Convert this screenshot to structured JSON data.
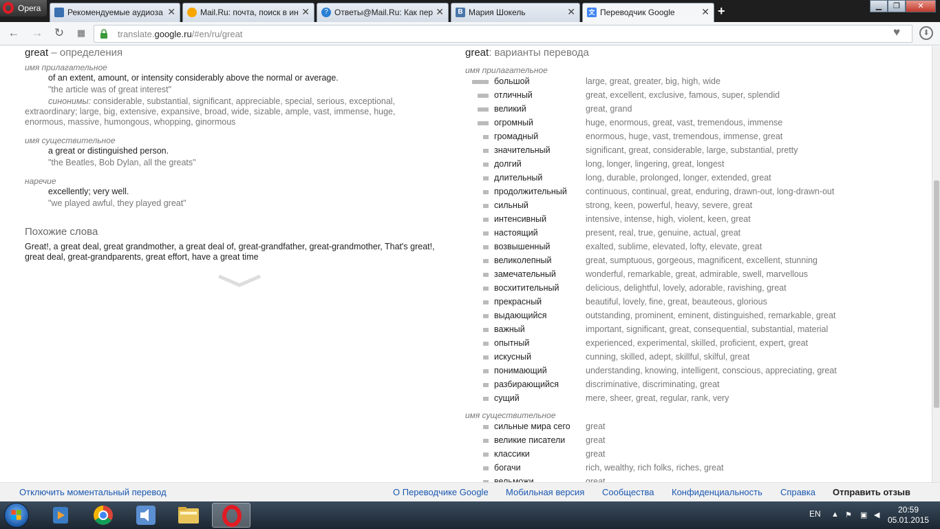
{
  "browser": {
    "menu_label": "Opera",
    "tabs": [
      {
        "title": "Рекомендуемые аудиоза",
        "favicon": "video-icon",
        "color": "#3a6fb0"
      },
      {
        "title": "Mail.Ru: почта, поиск в ин",
        "favicon": "mailru-icon",
        "color": "#1f7cc1"
      },
      {
        "title": "Ответы@Mail.Ru: Как пер",
        "favicon": "answers-icon",
        "color": "#2a7fd4"
      },
      {
        "title": "Мария Шокель",
        "favicon": "vk-icon",
        "color": "#4a76a8"
      },
      {
        "title": "Переводчик Google",
        "favicon": "google-translate-icon",
        "color": "#4285f4"
      }
    ],
    "url_prefix": "translate.",
    "url_domain": "google.ru",
    "url_path": "/#en/ru/great"
  },
  "definitions": {
    "word": "great",
    "title_suffix": "– определения",
    "adjective_label": "имя прилагательное",
    "adj_def": "of an extent, amount, or intensity considerably above the normal or average.",
    "adj_example": "\"the article was of great interest\"",
    "synonyms_label": "синонимы:",
    "synonyms_line1": "considerable, substantial, significant, appreciable, special, serious, exceptional,",
    "synonyms_line2": "extraordinary; large, big, extensive, expansive, broad, wide, sizable, ample, vast, immense, huge,",
    "synonyms_line3": "enormous, massive, humongous, whopping, ginormous",
    "noun_label": "имя существительное",
    "noun_def": "a great or distinguished person.",
    "noun_example": "\"the Beatles, Bob Dylan, all the greats\"",
    "adverb_label": "наречие",
    "adv_def": "excellently; very well.",
    "adv_example": "\"we played awful, they played great\"",
    "similar_title": "Похожие слова",
    "similar_line1": "Great!, a great deal, great grandmother, a great deal of, great-grandfather, great-grandmother, That's great!,",
    "similar_line2": "great deal, great-grandparents, great effort, have a great time"
  },
  "translations": {
    "word": "great",
    "title_suffix": ": варианты перевода",
    "adjective_label": "имя прилагательное",
    "noun_label": "имя существительное",
    "adjectives": [
      {
        "word": "большой",
        "trans": "large, great, greater, big, high, wide",
        "freq": 1.0
      },
      {
        "word": "отличный",
        "trans": "great, excellent, exclusive, famous, super, splendid",
        "freq": 0.67
      },
      {
        "word": "великий",
        "trans": "great, grand",
        "freq": 0.67
      },
      {
        "word": "огромный",
        "trans": "huge, enormous, great, vast, tremendous, immense",
        "freq": 0.67
      },
      {
        "word": "громадный",
        "trans": "enormous, huge, vast, tremendous, immense, great",
        "freq": 0.33
      },
      {
        "word": "значительный",
        "trans": "significant, great, considerable, large, substantial, pretty",
        "freq": 0.33
      },
      {
        "word": "долгий",
        "trans": "long, longer, lingering, great, longest",
        "freq": 0.33
      },
      {
        "word": "длительный",
        "trans": "long, durable, prolonged, longer, extended, great",
        "freq": 0.33
      },
      {
        "word": "продолжительный",
        "trans": "continuous, continual, great, enduring, drawn-out, long-drawn-out",
        "freq": 0.33
      },
      {
        "word": "сильный",
        "trans": "strong, keen, powerful, heavy, severe, great",
        "freq": 0.33
      },
      {
        "word": "интенсивный",
        "trans": "intensive, intense, high, violent, keen, great",
        "freq": 0.33
      },
      {
        "word": "настоящий",
        "trans": "present, real, true, genuine, actual, great",
        "freq": 0.33
      },
      {
        "word": "возвышенный",
        "trans": "exalted, sublime, elevated, lofty, elevate, great",
        "freq": 0.33
      },
      {
        "word": "великолепный",
        "trans": "great, sumptuous, gorgeous, magnificent, excellent, stunning",
        "freq": 0.33
      },
      {
        "word": "замечательный",
        "trans": "wonderful, remarkable, great, admirable, swell, marvellous",
        "freq": 0.33
      },
      {
        "word": "восхитительный",
        "trans": "delicious, delightful, lovely, adorable, ravishing, great",
        "freq": 0.33
      },
      {
        "word": "прекрасный",
        "trans": "beautiful, lovely, fine, great, beauteous, glorious",
        "freq": 0.33
      },
      {
        "word": "выдающийся",
        "trans": "outstanding, prominent, eminent, distinguished, remarkable, great",
        "freq": 0.33
      },
      {
        "word": "важный",
        "trans": "important, significant, great, consequential, substantial, material",
        "freq": 0.33
      },
      {
        "word": "опытный",
        "trans": "experienced, experimental, skilled, proficient, expert, great",
        "freq": 0.33
      },
      {
        "word": "искусный",
        "trans": "cunning, skilled, adept, skillful, skilful, great",
        "freq": 0.33
      },
      {
        "word": "понимающий",
        "trans": "understanding, knowing, intelligent, conscious, appreciating, great",
        "freq": 0.33
      },
      {
        "word": "разбирающийся",
        "trans": "discriminative, discriminating, great",
        "freq": 0.33
      },
      {
        "word": "сущий",
        "trans": "mere, sheer, great, regular, rank, very",
        "freq": 0.33
      }
    ],
    "nouns": [
      {
        "word": "сильные мира сего",
        "trans": "great",
        "freq": 0.33
      },
      {
        "word": "великие писатели",
        "trans": "great",
        "freq": 0.33
      },
      {
        "word": "классики",
        "trans": "great",
        "freq": 0.33
      },
      {
        "word": "богачи",
        "trans": "rich, wealthy, rich folks, riches, great",
        "freq": 0.33
      },
      {
        "word": "вельможи",
        "trans": "great",
        "freq": 0.33
      }
    ]
  },
  "footer": {
    "instant_off": "Отключить моментальный перевод",
    "about": "О Переводчике Google",
    "mobile": "Мобильная версия",
    "community": "Сообщества",
    "privacy": "Конфиденциальность",
    "help": "Справка",
    "feedback": "Отправить отзыв"
  },
  "taskbar": {
    "lang": "EN",
    "time": "20:59",
    "date": "05.01.2015"
  },
  "colors": {
    "link": "#1a57b0",
    "bar": "#bbbbbb",
    "opera_red": "#e01b24"
  }
}
